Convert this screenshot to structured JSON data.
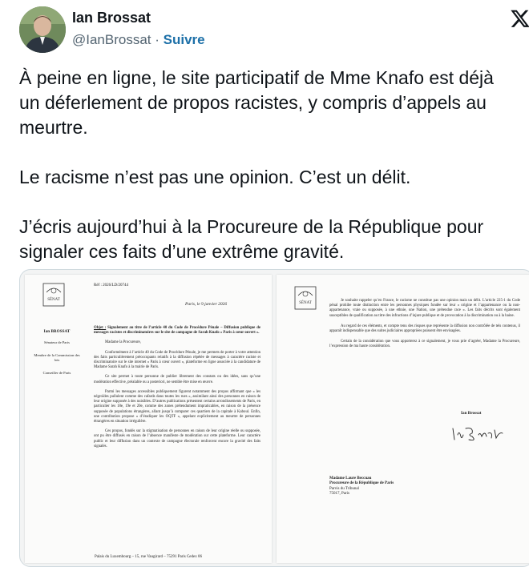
{
  "author": {
    "name": "Ian Brossat",
    "handle": "@IanBrossat",
    "separator": " · ",
    "follow_label": "Suivre",
    "avatar_icon": "avatar-photo",
    "platform_icon": "x-logo-icon"
  },
  "tweet": {
    "paragraph1_lines": [
      "À peine en ligne, le site participatif de Mme Knafo est déjà",
      "un déferlement de propos racistes, y compris d’appels au",
      "meurtre."
    ],
    "paragraph2": "Le racisme n’est pas une opinion. C’est un délit.",
    "paragraph3_lines": [
      "J’écris aujourd’hui à la Procureure de la République pour",
      "signaler ces faits d’une extrême gravité."
    ]
  },
  "letter": {
    "logo_text": "SÉNAT",
    "ref": "Réf : 2026/LD/20744",
    "date": "Paris, le 9 janvier 2026",
    "sidebar": {
      "name": "Ian BROSSAT",
      "title": "Sénateur de Paris",
      "commission": "Membre de la Commission des lois",
      "council": "Conseiller de Paris"
    },
    "objet_label": "Objet :",
    "objet_text": "Signalement au titre de l’article 40 du Code de Procédure Pénale – Diffusion publique de messages racistes et discriminatoires sur le site de campagne de Sarah Knafo « Paris à cœur ouvert ».",
    "salutation": "Madame la Procureure,",
    "p1": "Conformément à l’article 40 du Code de Procédure Pénale, je me permets de porter à votre attention des faits particulièrement préoccupants relatifs à la diffusion répétée de messages à caractère raciste et discriminatoire sur le site internet « Paris à cœur ouvert », plateforme en ligne associée à la candidature de Madame Sarah Knafo à la mairie de Paris.",
    "p2": "Ce site permet à toute personne de publier librement des constats ou des idées, sans qu’une modération effective, préalable ou a posteriori, ne semble être mise en œuvre.",
    "p3": "Parmi les messages accessibles publiquement figurent notamment des propos affirmant que « les négroïdes pullulent comme des cafards dans toutes les rues », assimilant ainsi des personnes en raison de leur origine supposée à des nuisibles. D’autres publications présentent certains arrondissements de Paris, en particulier les 18e, 19e et 20e, comme des zones prétendument impraticables, en raison de la présence supposée de populations étrangères, allant jusqu’à comparer ces quartiers de la capitale à Kaboul. Enfin, une contribution propose « d’éradiquer les OQTF », appelant explicitement au meurtre de personnes étrangères en situation irrégulière.",
    "p4": "Ces propos, fondés sur la stigmatisation de personnes en raison de leur origine réelle ou supposée, ont pu être diffusés en raison de l’absence manifeste de modération sur cette plateforme. Leur caractère public et leur diffusion dans un contexte de campagne électorale renforcent encore la gravité des faits signalés.",
    "footer": "Palais du Luxembourg – 15, rue Vaugirard – 75291 Paris Cedex 06",
    "p5": "Je souhaite rappeler qu’en France, le racisme ne constitue pas une opinion mais un délit. L’article 225-1 du Code pénal prohibe toute distinction entre les personnes physiques fondée sur leur « origine et l’appartenance ou la non-appartenance, vraie ou supposée, à une ethnie, une Nation, une prétendue race ». Les faits décrits sont également susceptibles de qualification au titre des infractions d’injure publique et de provocation à la discrimination ou à la haine.",
    "p6": "Au regard de ces éléments, et compte tenu des risques que représente la diffusion non contrôlée de tels contenus, il apparaît indispensable que des suites judiciaires appropriées puissent être envisagées.",
    "p7": "Certain de la considération que vous apporterez à ce signalement, je vous prie d’agréer, Madame la Procureure, l’expression de ma haute considération.",
    "signatory": "Ian Brossat",
    "signature_text": "Ian Brossat",
    "recipient_name": "Madame Laure Beccuau",
    "recipient_title": "Procureure de la République de Paris",
    "recipient_addr1": "Parvis du Tribunal",
    "recipient_addr2": "75017, Paris"
  }
}
